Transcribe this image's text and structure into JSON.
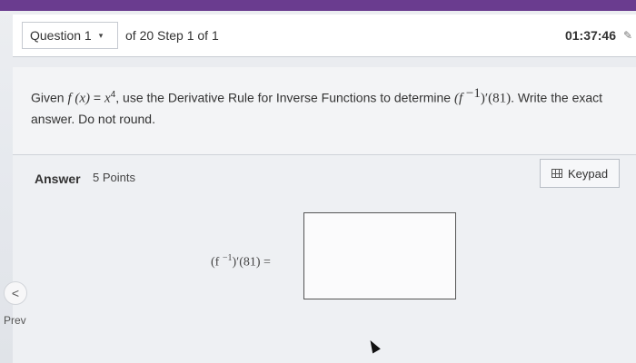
{
  "header": {
    "question_label": "Question 1",
    "of_step": "of 20 Step 1 of 1",
    "timer": "01:37:46"
  },
  "question": {
    "prefix": "Given ",
    "f_of_x": "f (x)",
    "eq": " = ",
    "x_base": "x",
    "x_exp": "4",
    "middle": ", use the Derivative Rule for Inverse Functions to determine ",
    "finv_base": "(f ",
    "finv_exp": "−1",
    "finv_prime": ")′",
    "finv_arg": "(81)",
    "suffix": ". Write the exact answer. Do not round."
  },
  "answer": {
    "label": "Answer",
    "points": "5 Points",
    "keypad_label": "Keypad",
    "expr_base": "(f ",
    "expr_exp": "−1",
    "expr_tail": ")′(81) ="
  },
  "nav": {
    "prev_label": "Prev",
    "prev_arrow": "<"
  },
  "icons": {
    "caret": "▾",
    "pencil": "✎"
  }
}
